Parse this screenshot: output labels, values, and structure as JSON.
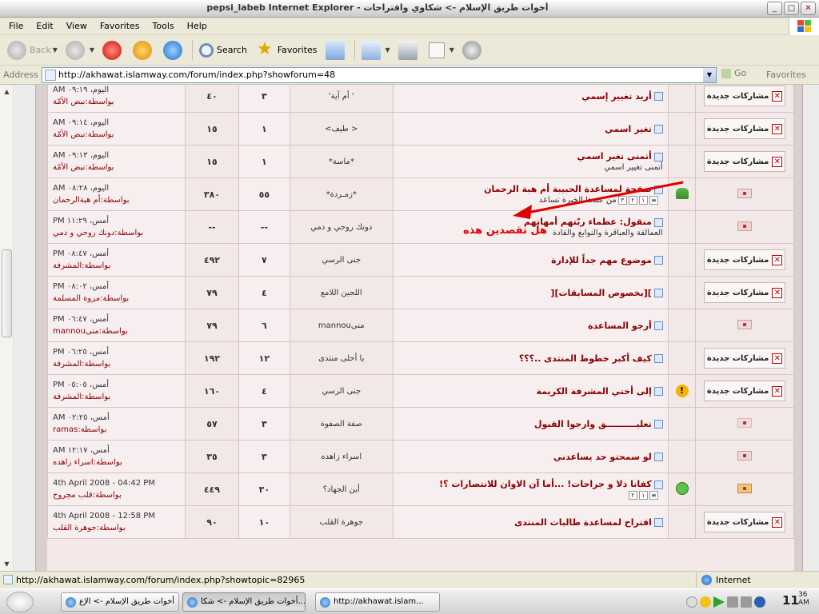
{
  "window": {
    "title": "pepsi_labeb Internet Explorer - أخوات طريق الإسلام -> شكاوي واقتراحات",
    "min": "_",
    "max": "□",
    "close": "✕"
  },
  "menu": [
    "File",
    "Edit",
    "View",
    "Favorites",
    "Tools",
    "Help"
  ],
  "toolbar": {
    "back": "Back",
    "search": "Search",
    "favorites": "Favorites"
  },
  "address": {
    "label": "Address",
    "url": "http://akhawat.islamway.com/forum/index.php?showforum=48",
    "go": "Go",
    "favorites": "Favorites"
  },
  "badge": "مشاركات جديدة",
  "rows": [
    {
      "status": "new",
      "icon": "",
      "title": "أريد تغيير إسمي",
      "sub": "",
      "author": "' أم آية'",
      "replies": "٣",
      "views": "٤٠",
      "time": "اليوم، ٠٩:١٩ AM",
      "by": "بواسطة:نبض الأمّة"
    },
    {
      "status": "new",
      "icon": "",
      "title": "تغير اسمي",
      "sub": "",
      "author": "< طيف>",
      "replies": "١",
      "views": "١٥",
      "time": "اليوم، ٠٩:١٤ AM",
      "by": "بواسطة:نبض الأمّة"
    },
    {
      "status": "new",
      "icon": "",
      "title": "أتمنى تغير اسمي",
      "sub": "أتمنى تغيير اسمي",
      "author": "*ماسة*",
      "replies": "١",
      "views": "١٥",
      "time": "اليوم، ٠٩:١٣ AM",
      "by": "بواسطة:نبض الأمّة"
    },
    {
      "status": "hot",
      "icon": "palm",
      "title": "صفحة لمساعدة الحبيبة أم هبة الرحمان",
      "sub": "من عندها الخبرة تساعد",
      "pages": [
        "١",
        "٢",
        "٣"
      ],
      "author": "*زمـردة*",
      "replies": "٥٥",
      "views": "٣٨٠",
      "time": "اليوم، ٠٨:٢٨ AM",
      "by": "بواسطة:أم هبةالرحمان"
    },
    {
      "status": "moved",
      "icon": "",
      "title": "منقول: عظماء ربّتهم أمهاتهم",
      "sub": "العمالقة والعباقرة والنوابغ والقادة",
      "author": "دونك روحي و دمي",
      "replies": "--",
      "views": "--",
      "time": "أمس، ١١:٢٩ PM",
      "by": "بواسطة:دونك روحي و دمي"
    },
    {
      "status": "new",
      "icon": "",
      "title": "موضوع مهم جداً للإدارة",
      "sub": "",
      "author": "جنى الرسي",
      "replies": "٧",
      "views": "٤٩٢",
      "time": "أمس، ٠٨:٤٧ PM",
      "by": "بواسطة:المشرفة"
    },
    {
      "status": "new",
      "icon": "",
      "title": "][بخصوص المسابقات][",
      "sub": "",
      "author": "اللجين اللامع",
      "replies": "٤",
      "views": "٧٩",
      "time": "أمس، ٠٨:٠٢ PM",
      "by": "بواسطة:مروة المسلمة"
    },
    {
      "status": "normal",
      "icon": "",
      "title": "أرجو المساعدة",
      "sub": "",
      "author": "منىmannou",
      "replies": "٦",
      "views": "٧٩",
      "time": "أمس، ٠٦:٤٧ PM",
      "by": "بواسطة:منىmannou"
    },
    {
      "status": "new",
      "icon": "",
      "title": "كيف أكبر خطوط المنتدى ..؟؟؟",
      "sub": "",
      "author": "يا أحلى منتدى",
      "replies": "١٢",
      "views": "١٩٢",
      "time": "أمس، ٠٦:٢٥ PM",
      "by": "بواسطة:المشرفة"
    },
    {
      "status": "new",
      "icon": "warning",
      "title": "إلى أختي المشرفة الكريمة",
      "sub": "",
      "author": "جنى الرسي",
      "replies": "٤",
      "views": "١٦٠",
      "time": "أمس، ٠٥:٠٥ PM",
      "by": "بواسطة:المشرفة"
    },
    {
      "status": "read",
      "icon": "",
      "title": "تعليــــــــــق وارجوا القبول",
      "sub": "",
      "author": "صفة الصفوة",
      "replies": "٣",
      "views": "٥٧",
      "time": "أمس، ٠٢:٢٥ AM",
      "by": "بواسطة:ramas"
    },
    {
      "status": "normal",
      "icon": "",
      "title": "لو سمحتو حد يساعدني",
      "sub": "",
      "author": "اسراء زاهده",
      "replies": "٣",
      "views": "٣٥",
      "time": "أمس، ١٢:١٧ AM",
      "by": "بواسطة:اسراء زاهده"
    },
    {
      "status": "mail",
      "icon": "smile",
      "title": "كفانا ذلا و جراحات! ...أما آن الاوان للانتصارات ؟!",
      "sub": "",
      "pages": [
        "١",
        "٢"
      ],
      "author": "أين الجهاد؟",
      "replies": "٣٠",
      "views": "٤٤٩",
      "time": "4th April 2008 - 04:42 PM",
      "by": "بواسطة:قلب مجروح"
    },
    {
      "status": "new",
      "icon": "",
      "title": "اقتراح لمساعدة طالبات المنتدى",
      "sub": "",
      "author": "جوهرة القلب",
      "replies": "١٠",
      "views": "٩٠",
      "time": "4th April 2008 - 12:58 PM",
      "by": "بواسطة:جوهرة القلب"
    }
  ],
  "annotation": "هل تقصدين هذه",
  "status": {
    "url": "http://akhawat.islamway.com/forum/index.php?showtopic=82965",
    "zone": "Internet"
  },
  "taskbar": {
    "tasks": [
      "أخوات طريق الإسلام -> الإع",
      "أخوات طريق الإسلام -> شكا...",
      "http://akhawat.islam..."
    ],
    "clock": "11",
    "clock_min": "36",
    "clock_ampm": "AM"
  }
}
